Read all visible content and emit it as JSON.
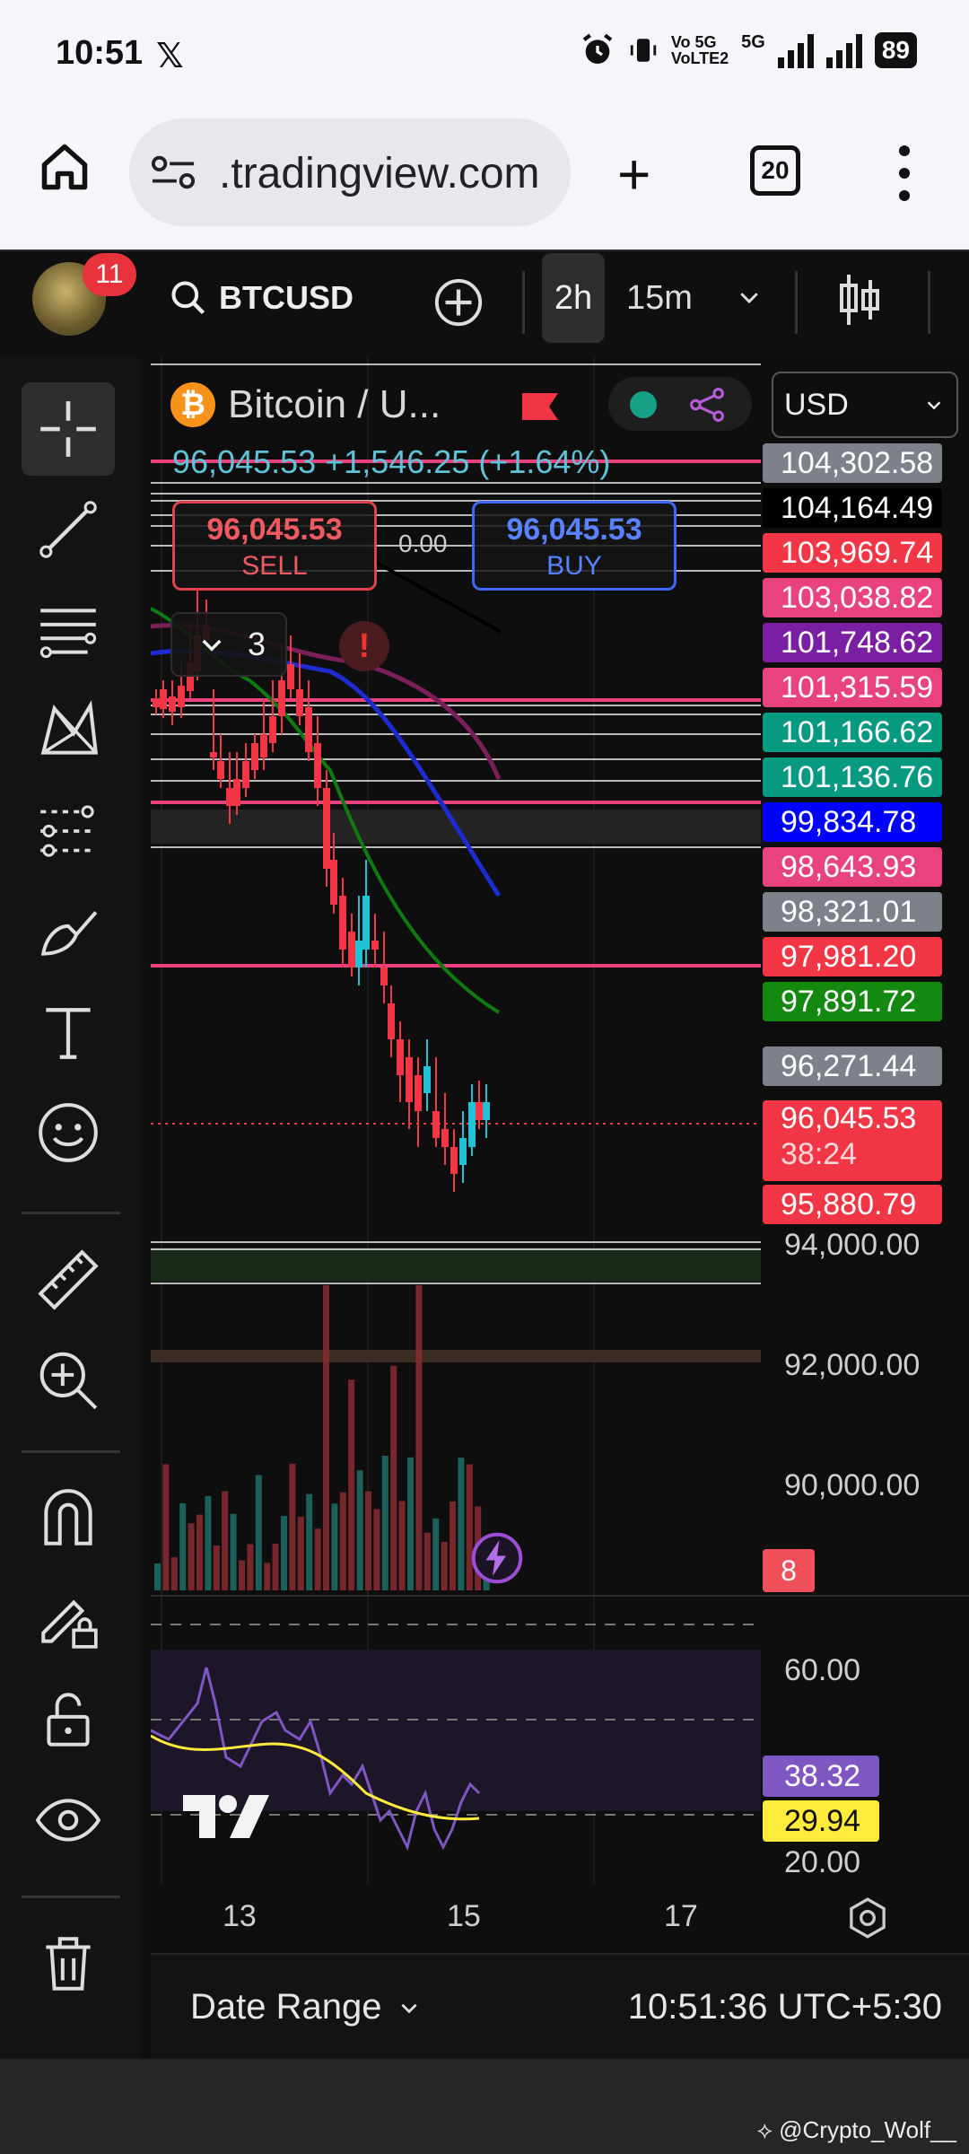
{
  "status_bar": {
    "time": "10:51",
    "x_logo": "𝕏",
    "net1": "Vo 5G",
    "net2": "VoLTE2",
    "net3": "5G",
    "battery": "89"
  },
  "browser": {
    "url": ".tradingview.com",
    "tab_count": "20"
  },
  "toolbar": {
    "notification_count": "11",
    "symbol": "BTCUSD",
    "timeframe_active": "2h",
    "timeframe_secondary": "15m"
  },
  "legend": {
    "symbol_name": "Bitcoin / U...",
    "price_line": "96,045.53  +1,546.25 (+1.64%)",
    "sell_price": "96,045.53",
    "sell_label": "SELL",
    "buy_price": "96,045.53",
    "buy_label": "BUY",
    "spread": "0.00",
    "collapsed_count": "3",
    "alert": "!"
  },
  "currency": "USD",
  "price_labels": [
    {
      "text": "104,302.58",
      "color": "#7d8189"
    },
    {
      "text": "104,164.49",
      "color": "#000000"
    },
    {
      "text": "103,969.74",
      "color": "#f23645"
    },
    {
      "text": "103,038.82",
      "color": "#e8437f"
    },
    {
      "text": "101,748.62",
      "color": "#7b1fa2"
    },
    {
      "text": "101,315.59",
      "color": "#e8437f"
    },
    {
      "text": "101,166.62",
      "color": "#089981"
    },
    {
      "text": "101,136.76",
      "color": "#089981"
    },
    {
      "text": "99,834.78",
      "color": "#0000ff"
    },
    {
      "text": "98,643.93",
      "color": "#e8437f"
    },
    {
      "text": "98,321.01",
      "color": "#7d8189"
    },
    {
      "text": "97,981.20",
      "color": "#f23645"
    },
    {
      "text": "97,891.72",
      "color": "#138a0f"
    },
    {
      "text": "96,271.44",
      "color": "#7d8189"
    }
  ],
  "current_price": {
    "price": "96,045.53",
    "timer": "38:24"
  },
  "low_label": {
    "text": "95,880.79",
    "color": "#f23645"
  },
  "axis_labels": [
    "94,000.00",
    "92,000.00",
    "90,000.00"
  ],
  "volume_badge": "8",
  "rsi": {
    "levels": [
      "60.00",
      "20.00"
    ],
    "rsi_value": "38.32",
    "rsi_color": "#7e57c2",
    "ma_value": "29.94",
    "ma_color": "#ffeb3b"
  },
  "date_labels": [
    "13",
    "15",
    "17"
  ],
  "bottom": {
    "date_range": "Date Range",
    "clock": "10:51:36 UTC+5:30"
  },
  "credit": "@Crypto_Wolf__",
  "colors": {
    "up": "#22c1d6",
    "down": "#f23645",
    "background": "#0e0e0e",
    "accent_pink": "#e8437f"
  }
}
